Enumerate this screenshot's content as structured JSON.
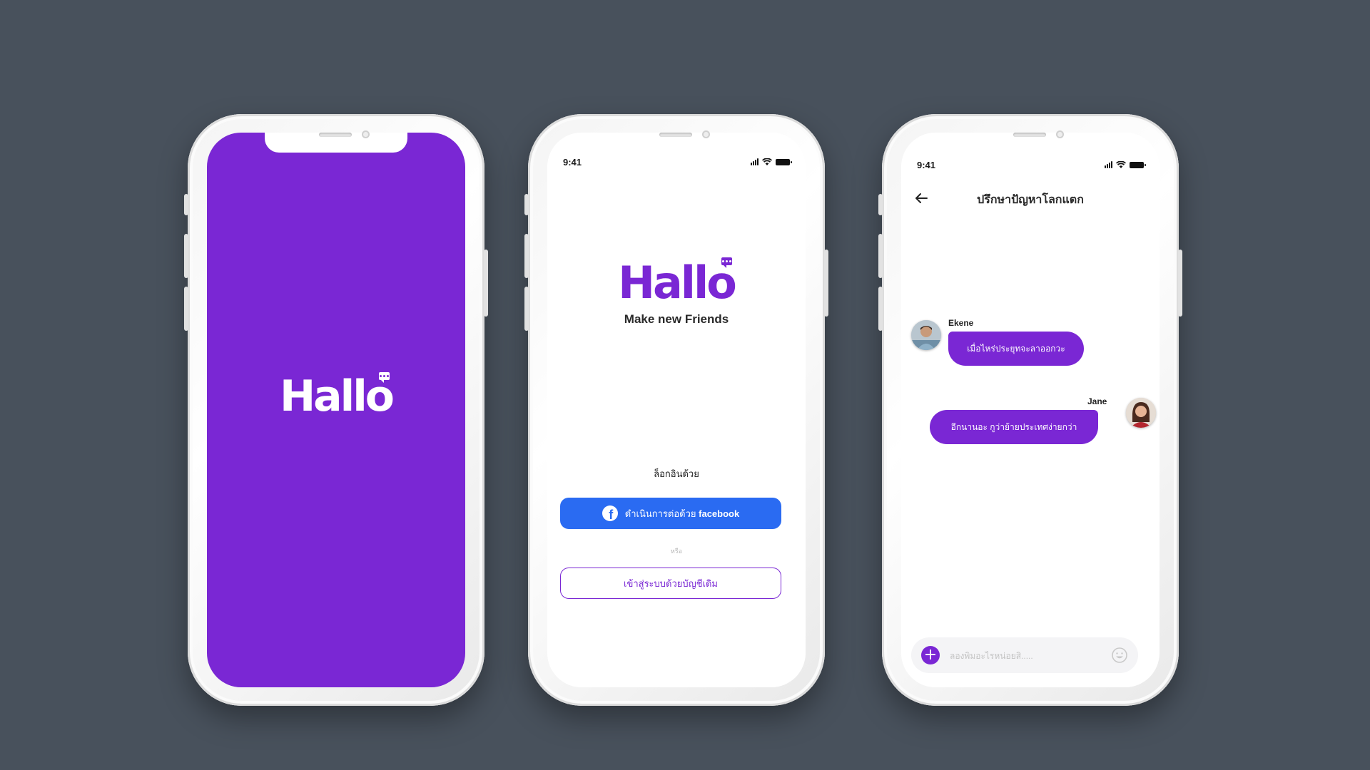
{
  "colors": {
    "background": "#48515c",
    "brand_purple": "#7a27d4",
    "facebook_blue": "#2a6bf2",
    "screen_white": "#ffffff"
  },
  "splash": {
    "logo_text": "Hallo"
  },
  "login": {
    "status_time": "9:41",
    "logo_text": "Hallo",
    "tagline": "Make new Friends",
    "login_with": "ล็อกอินด้วย",
    "facebook_button": {
      "label": "ดำเนินการต่อด้วย",
      "brand": "facebook",
      "icon": "facebook-icon"
    },
    "or_text": "หรือ",
    "account_button_label": "เข้าสู่ระบบด้วยบัญชีเดิม"
  },
  "chat": {
    "status_time": "9:41",
    "title": "ปรึกษาปัญหาโลกแตก",
    "back_icon": "arrow-left-icon",
    "messages": [
      {
        "sender": "Ekene",
        "text": "เมื่อไหร่ประยุทจะลาออกวะ",
        "direction": "incoming"
      },
      {
        "sender": "Jane",
        "text": "อีกนานอะ กูว่าย้ายประเทศง่ายกว่า",
        "direction": "outgoing"
      }
    ],
    "composer": {
      "placeholder": "ลองพิมอะไรหน่อยสิ.....",
      "add_icon": "plus-icon",
      "emoji_icon": "smiley-icon"
    }
  }
}
